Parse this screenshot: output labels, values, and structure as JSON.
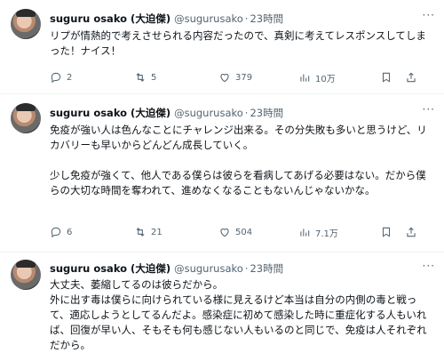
{
  "tweets": [
    {
      "name": "suguru osako (大迫傑)",
      "handle": "@sugurusako",
      "time": "23時間",
      "text": "リプが情熱的で考えさせられる内容だったので、真剣に考えてレスポンスしてしまった！ナイス！",
      "replies": "2",
      "retweets": "5",
      "likes": "379",
      "views": "10万"
    },
    {
      "name": "suguru osako (大迫傑)",
      "handle": "@sugurusako",
      "time": "23時間",
      "text": "免疫が強い人は色んなことにチャレンジ出来る。その分失敗も多いと思うけど、リカバリーも早いからどんどん成長していく。\n\n少し免疫が強くて、他人である僕らは彼らを看病してあげる必要はない。だから僕らの大切な時間を奪われて、進めなくなることもないんじゃないかな。",
      "replies": "6",
      "retweets": "21",
      "likes": "504",
      "views": "7.1万"
    },
    {
      "name": "suguru osako (大迫傑)",
      "handle": "@sugurusako",
      "time": "23時間",
      "text": "大丈夫、萎縮してるのは彼らだから。\n外に出す毒は僕らに向けられている様に見えるけど本当は自分の内側の毒と戦って、適応しようとしてるんだよ。感染症に初めて感染した時に重症化する人もいれば、回復が早い人、そもそも何も感じない人もいるのと同じで、免疫は人それぞれだから。"
    }
  ],
  "colors": {
    "text": "#0f1419",
    "muted": "#536471",
    "divider": "#eff3f4"
  },
  "icons": [
    "reply-icon",
    "retweet-icon",
    "like-icon",
    "views-icon",
    "bookmark-icon",
    "share-icon",
    "more-icon"
  ]
}
